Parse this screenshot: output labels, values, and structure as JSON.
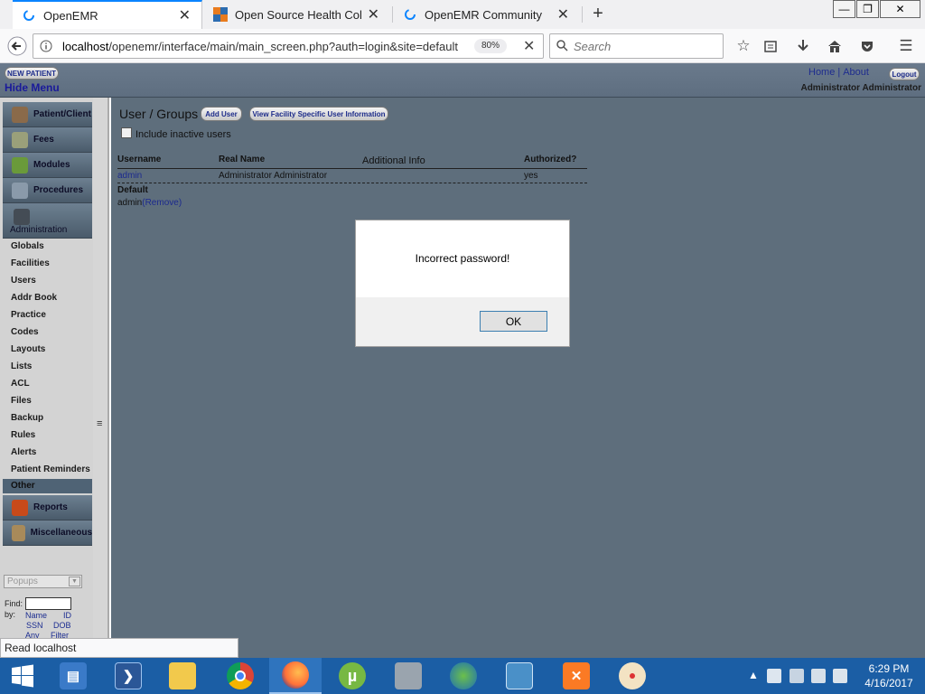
{
  "browser": {
    "tabs": [
      {
        "label": "OpenEMR",
        "active": true
      },
      {
        "label": "Open Source Health Colla...",
        "active": false
      },
      {
        "label": "OpenEMR Community",
        "active": false
      }
    ],
    "url_host": "localhost",
    "url_path": "/openemr/interface/main/main_screen.php?auth=login&site=default",
    "zoom": "80%",
    "search_placeholder": "Search",
    "status_text": "Read localhost"
  },
  "header": {
    "new_patient": "NEW PATIENT",
    "hide_menu": "Hide Menu",
    "home": "Home",
    "about": "About",
    "logout": "Logout",
    "user_name": "Administrator Administrator"
  },
  "menu": {
    "sections": [
      "Patient/Client",
      "Fees",
      "Modules",
      "Procedures",
      "Administration"
    ],
    "admin_items": [
      "Globals",
      "Facilities",
      "Users",
      "Addr Book",
      "Practice",
      "Codes",
      "Layouts",
      "Lists",
      "ACL",
      "Files",
      "Backup",
      "Rules",
      "Alerts",
      "Patient Reminders"
    ],
    "other": "Other",
    "reports": "Reports",
    "miscellaneous": "Miscellaneous",
    "popups_placeholder": "Popups",
    "find_label": "Find:",
    "by_label": "by:",
    "find_links": [
      "Name",
      "ID",
      "SSN",
      "DOB",
      "Any",
      "Filter"
    ]
  },
  "main": {
    "title": "User / Groups",
    "add_user": "Add User",
    "view_facility": "View Facility Specific User Information",
    "include_inactive": "Include inactive users",
    "columns": [
      "Username",
      "Real Name",
      "Additional Info",
      "Authorized?"
    ],
    "rows": [
      {
        "username": "admin",
        "real_name": "Administrator Administrator",
        "info": "",
        "authorized": "yes"
      }
    ],
    "group_name": "Default",
    "group_member": "admin",
    "group_remove": "(Remove)"
  },
  "dialog": {
    "message": "Incorrect password!",
    "ok": "OK"
  },
  "taskbar": {
    "time": "6:29 PM",
    "date": "4/16/2017"
  },
  "colors": {
    "emr_header": "#64748a",
    "main_bg": "#5e6e7c",
    "taskbar": "#1b5ea5",
    "link": "#1c2a8e"
  }
}
